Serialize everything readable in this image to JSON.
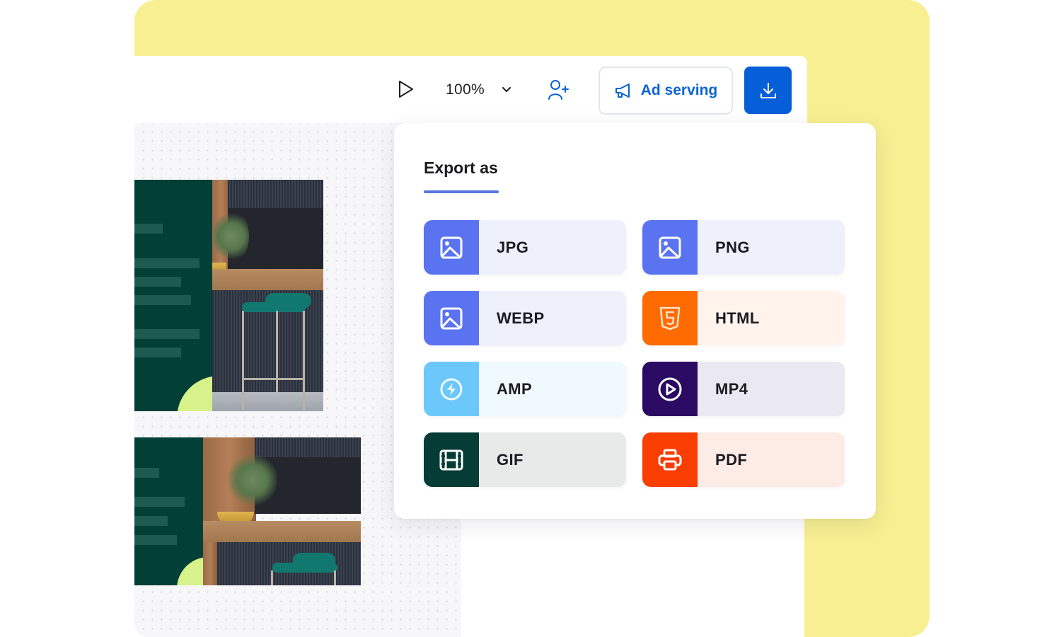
{
  "toolbar": {
    "zoom_value": "100%",
    "ad_serving_label": "Ad serving",
    "icons": {
      "play": "play-icon",
      "zoom_dropdown": "chevron-down-icon",
      "share": "add-user-icon",
      "ad_serving": "megaphone-icon",
      "download": "download-icon"
    }
  },
  "colors": {
    "background_accent": "#f8ef92",
    "primary": "#065fd8",
    "ad_serving_text": "#0a63d6",
    "design_panel": "#013f37",
    "design_accent": "#d7f28a"
  },
  "export_panel": {
    "title": "Export as",
    "underline_color": "#5a73e0",
    "options": [
      {
        "label": "JPG",
        "icon": "image-icon",
        "icon_bg": "#5a73f0",
        "bg": "#eef0fc"
      },
      {
        "label": "PNG",
        "icon": "image-icon",
        "icon_bg": "#5a73f0",
        "bg": "#eef0fc"
      },
      {
        "label": "WEBP",
        "icon": "image-icon",
        "icon_bg": "#5a73f0",
        "bg": "#eef0fc"
      },
      {
        "label": "HTML",
        "icon": "html5-icon",
        "icon_bg": "#ff6b00",
        "bg": "#fff3ec"
      },
      {
        "label": "AMP",
        "icon": "amp-bolt-icon",
        "icon_bg": "#6cc8fb",
        "bg": "#eff9fe"
      },
      {
        "label": "MP4",
        "icon": "play-circle-icon",
        "icon_bg": "#2a0a62",
        "bg": "#eae8f1"
      },
      {
        "label": "GIF",
        "icon": "film-icon",
        "icon_bg": "#053c36",
        "bg": "#e8eaea"
      },
      {
        "label": "PDF",
        "icon": "printer-icon",
        "icon_bg": "#fa3d00",
        "bg": "#fdebe6"
      }
    ]
  }
}
